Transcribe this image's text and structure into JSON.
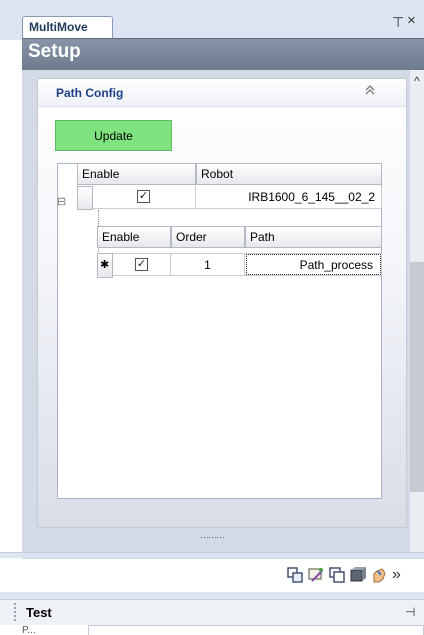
{
  "window": {
    "tab_label": "MultiMove",
    "pin_glyph": "⊤",
    "close_glyph": "×"
  },
  "setup": {
    "title": "Setup"
  },
  "panel": {
    "title": "Path Config",
    "collapse_glyph": "⌃"
  },
  "update_button": {
    "label": "Update"
  },
  "robots_grid": {
    "headers": [
      "Enable",
      "Robot"
    ],
    "rows": [
      {
        "enable": true,
        "robot": "IRB1600_6_145__02_2"
      }
    ]
  },
  "paths_grid": {
    "headers": [
      "Enable",
      "Order",
      "Path"
    ],
    "rows": [
      {
        "enable": true,
        "order": "1",
        "path": "Path_process"
      }
    ],
    "new_row_glyph": "✱"
  },
  "expand_glyph": "⊟",
  "checkmark_glyph": "✓",
  "splitter_grip": "⋯⋯⋯",
  "toolbar": {
    "overflow_glyph": "»"
  },
  "bottom_panel": {
    "title": "Test",
    "pin_glyph": "⊣",
    "partial_label": "P..."
  },
  "colors": {
    "accent_blue": "#1f3f8a",
    "update_green": "#7ee27e",
    "header_gray": "#7c889b"
  }
}
